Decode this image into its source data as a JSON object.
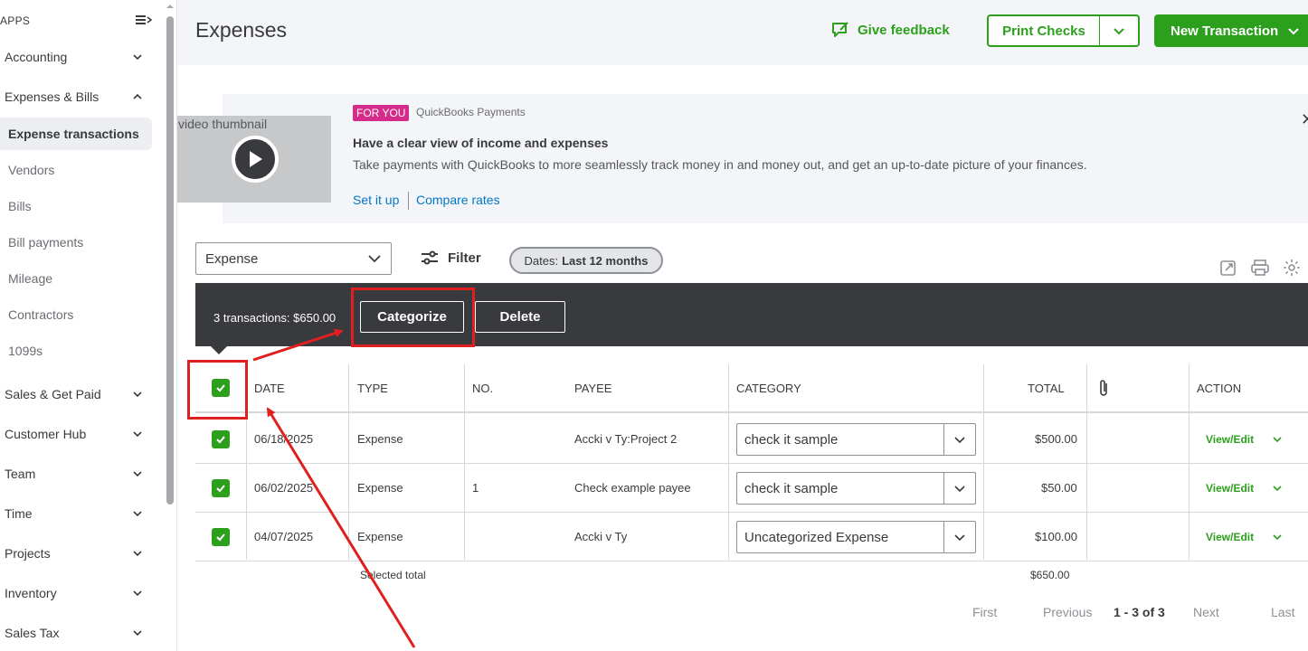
{
  "sidebar": {
    "apps_label": "APPS",
    "items": [
      {
        "label": "Accounting"
      },
      {
        "label": "Expenses & Bills"
      },
      {
        "label": "Sales & Get Paid"
      },
      {
        "label": "Customer Hub"
      },
      {
        "label": "Team"
      },
      {
        "label": "Time"
      },
      {
        "label": "Projects"
      },
      {
        "label": "Inventory"
      },
      {
        "label": "Sales Tax"
      }
    ],
    "sub_items": [
      {
        "label": "Expense transactions"
      },
      {
        "label": "Vendors"
      },
      {
        "label": "Bills"
      },
      {
        "label": "Bill payments"
      },
      {
        "label": "Mileage"
      },
      {
        "label": "Contractors"
      },
      {
        "label": "1099s"
      }
    ]
  },
  "header": {
    "title": "Expenses",
    "feedback_label": "Give feedback",
    "print_checks_label": "Print Checks",
    "new_transaction_label": "New Transaction"
  },
  "promo": {
    "thumbnail_alt": "video thumbnail",
    "badge": "FOR YOU",
    "source": "QuickBooks Payments",
    "title": "Have a clear view of income and expenses",
    "description": "Take payments with QuickBooks to more seamlessly track money in and money out, and get an up-to-date picture of your finances.",
    "link1": "Set it up",
    "link2": "Compare rates"
  },
  "controls": {
    "type_value": "Expense",
    "filter_label": "Filter",
    "date_prefix": "Dates:",
    "date_value": "Last 12 months"
  },
  "batch": {
    "count_text": "3 transactions: $650.00",
    "categorize_label": "Categorize",
    "delete_label": "Delete"
  },
  "table": {
    "columns": [
      "DATE",
      "TYPE",
      "NO.",
      "PAYEE",
      "CATEGORY",
      "TOTAL",
      "ACTION"
    ],
    "rows": [
      {
        "date": "06/18/2025",
        "type": "Expense",
        "no": "",
        "payee": "Accki v Ty:Project 2",
        "category": "check it sample",
        "total": "$500.00",
        "action": "View/Edit"
      },
      {
        "date": "06/02/2025",
        "type": "Expense",
        "no": "1",
        "payee": "Check example payee",
        "category": "check it sample",
        "total": "$50.00",
        "action": "View/Edit"
      },
      {
        "date": "04/07/2025",
        "type": "Expense",
        "no": "",
        "payee": "Accki v Ty",
        "category": "Uncategorized Expense",
        "total": "$100.00",
        "action": "View/Edit"
      }
    ],
    "selected_total_label": "Selected total",
    "selected_total_value": "$650.00"
  },
  "pagination": {
    "first": "First",
    "previous": "Previous",
    "range": "1 - 3 of 3",
    "next": "Next",
    "last": "Last"
  },
  "colors": {
    "brand_green": "#2ca01c",
    "annotation_red": "#e02020",
    "batch_bar": "#393a3d",
    "badge_pink": "#d52b8a",
    "link_blue": "#0077c5"
  }
}
